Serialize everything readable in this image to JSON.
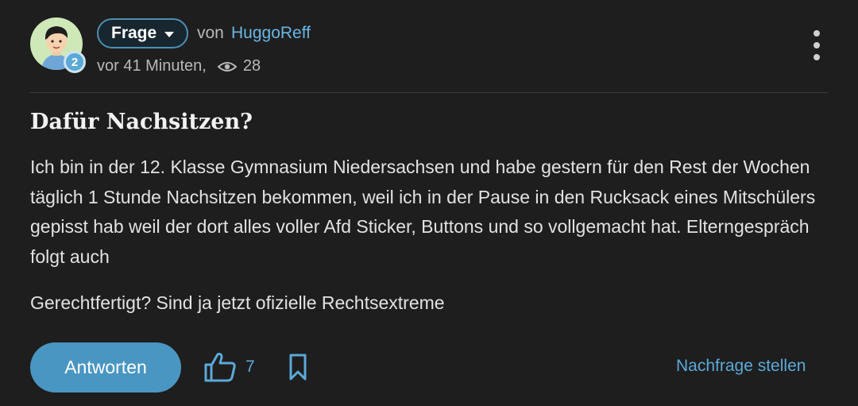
{
  "post": {
    "type_label": "Frage",
    "by_label": "von",
    "author": "HuggoReff",
    "author_level": "2",
    "time_ago": "vor 41 Minuten,",
    "views": "28",
    "title": "Dafür Nachsitzen?",
    "body": [
      "Ich bin in der 12. Klasse Gymnasium Niedersachsen und habe gestern für den Rest der Wochen täglich 1 Stunde Nachsitzen bekommen, weil ich in der Pause in den Rucksack eines Mitschülers gepisst hab weil der dort alles voller Afd Sticker, Buttons und so vollgemacht hat. Elterngespräch folgt auch",
      "Gerechtfertigt? Sind ja jetzt ofizielle Rechtsextreme"
    ]
  },
  "actions": {
    "answer_label": "Antworten",
    "like_count": "7",
    "followup_label": "Nachfrage stellen"
  },
  "icons": {
    "dropdown": "caret-down-icon",
    "views": "eye-icon",
    "more": "more-vertical-icon",
    "like": "thumbs-up-icon",
    "bookmark": "bookmark-icon"
  },
  "colors": {
    "background": "#1e1e1e",
    "accent": "#5ba9d8",
    "button": "#4a96c2",
    "text": "#e2e2e2",
    "muted": "#b9b9b9"
  }
}
